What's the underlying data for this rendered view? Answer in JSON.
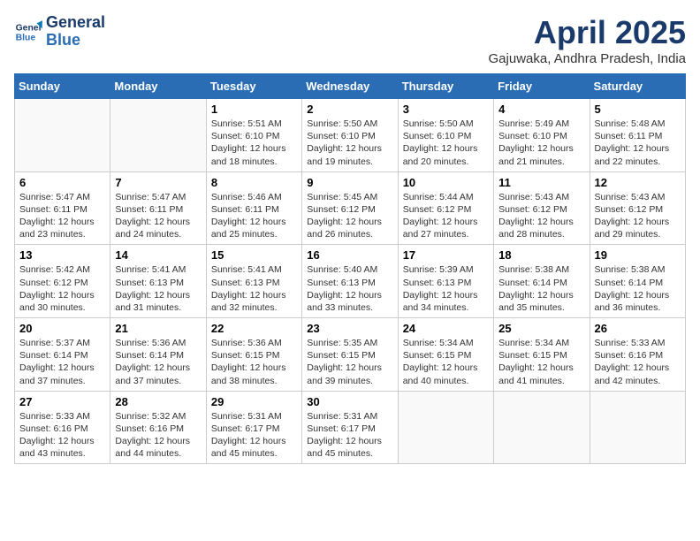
{
  "logo": {
    "line1": "General",
    "line2": "Blue"
  },
  "title": "April 2025",
  "subtitle": "Gajuwaka, Andhra Pradesh, India",
  "days_of_week": [
    "Sunday",
    "Monday",
    "Tuesday",
    "Wednesday",
    "Thursday",
    "Friday",
    "Saturday"
  ],
  "weeks": [
    [
      {
        "day": "",
        "info": ""
      },
      {
        "day": "",
        "info": ""
      },
      {
        "day": "1",
        "info": "Sunrise: 5:51 AM\nSunset: 6:10 PM\nDaylight: 12 hours and 18 minutes."
      },
      {
        "day": "2",
        "info": "Sunrise: 5:50 AM\nSunset: 6:10 PM\nDaylight: 12 hours and 19 minutes."
      },
      {
        "day": "3",
        "info": "Sunrise: 5:50 AM\nSunset: 6:10 PM\nDaylight: 12 hours and 20 minutes."
      },
      {
        "day": "4",
        "info": "Sunrise: 5:49 AM\nSunset: 6:10 PM\nDaylight: 12 hours and 21 minutes."
      },
      {
        "day": "5",
        "info": "Sunrise: 5:48 AM\nSunset: 6:11 PM\nDaylight: 12 hours and 22 minutes."
      }
    ],
    [
      {
        "day": "6",
        "info": "Sunrise: 5:47 AM\nSunset: 6:11 PM\nDaylight: 12 hours and 23 minutes."
      },
      {
        "day": "7",
        "info": "Sunrise: 5:47 AM\nSunset: 6:11 PM\nDaylight: 12 hours and 24 minutes."
      },
      {
        "day": "8",
        "info": "Sunrise: 5:46 AM\nSunset: 6:11 PM\nDaylight: 12 hours and 25 minutes."
      },
      {
        "day": "9",
        "info": "Sunrise: 5:45 AM\nSunset: 6:12 PM\nDaylight: 12 hours and 26 minutes."
      },
      {
        "day": "10",
        "info": "Sunrise: 5:44 AM\nSunset: 6:12 PM\nDaylight: 12 hours and 27 minutes."
      },
      {
        "day": "11",
        "info": "Sunrise: 5:43 AM\nSunset: 6:12 PM\nDaylight: 12 hours and 28 minutes."
      },
      {
        "day": "12",
        "info": "Sunrise: 5:43 AM\nSunset: 6:12 PM\nDaylight: 12 hours and 29 minutes."
      }
    ],
    [
      {
        "day": "13",
        "info": "Sunrise: 5:42 AM\nSunset: 6:12 PM\nDaylight: 12 hours and 30 minutes."
      },
      {
        "day": "14",
        "info": "Sunrise: 5:41 AM\nSunset: 6:13 PM\nDaylight: 12 hours and 31 minutes."
      },
      {
        "day": "15",
        "info": "Sunrise: 5:41 AM\nSunset: 6:13 PM\nDaylight: 12 hours and 32 minutes."
      },
      {
        "day": "16",
        "info": "Sunrise: 5:40 AM\nSunset: 6:13 PM\nDaylight: 12 hours and 33 minutes."
      },
      {
        "day": "17",
        "info": "Sunrise: 5:39 AM\nSunset: 6:13 PM\nDaylight: 12 hours and 34 minutes."
      },
      {
        "day": "18",
        "info": "Sunrise: 5:38 AM\nSunset: 6:14 PM\nDaylight: 12 hours and 35 minutes."
      },
      {
        "day": "19",
        "info": "Sunrise: 5:38 AM\nSunset: 6:14 PM\nDaylight: 12 hours and 36 minutes."
      }
    ],
    [
      {
        "day": "20",
        "info": "Sunrise: 5:37 AM\nSunset: 6:14 PM\nDaylight: 12 hours and 37 minutes."
      },
      {
        "day": "21",
        "info": "Sunrise: 5:36 AM\nSunset: 6:14 PM\nDaylight: 12 hours and 37 minutes."
      },
      {
        "day": "22",
        "info": "Sunrise: 5:36 AM\nSunset: 6:15 PM\nDaylight: 12 hours and 38 minutes."
      },
      {
        "day": "23",
        "info": "Sunrise: 5:35 AM\nSunset: 6:15 PM\nDaylight: 12 hours and 39 minutes."
      },
      {
        "day": "24",
        "info": "Sunrise: 5:34 AM\nSunset: 6:15 PM\nDaylight: 12 hours and 40 minutes."
      },
      {
        "day": "25",
        "info": "Sunrise: 5:34 AM\nSunset: 6:15 PM\nDaylight: 12 hours and 41 minutes."
      },
      {
        "day": "26",
        "info": "Sunrise: 5:33 AM\nSunset: 6:16 PM\nDaylight: 12 hours and 42 minutes."
      }
    ],
    [
      {
        "day": "27",
        "info": "Sunrise: 5:33 AM\nSunset: 6:16 PM\nDaylight: 12 hours and 43 minutes."
      },
      {
        "day": "28",
        "info": "Sunrise: 5:32 AM\nSunset: 6:16 PM\nDaylight: 12 hours and 44 minutes."
      },
      {
        "day": "29",
        "info": "Sunrise: 5:31 AM\nSunset: 6:17 PM\nDaylight: 12 hours and 45 minutes."
      },
      {
        "day": "30",
        "info": "Sunrise: 5:31 AM\nSunset: 6:17 PM\nDaylight: 12 hours and 45 minutes."
      },
      {
        "day": "",
        "info": ""
      },
      {
        "day": "",
        "info": ""
      },
      {
        "day": "",
        "info": ""
      }
    ]
  ]
}
